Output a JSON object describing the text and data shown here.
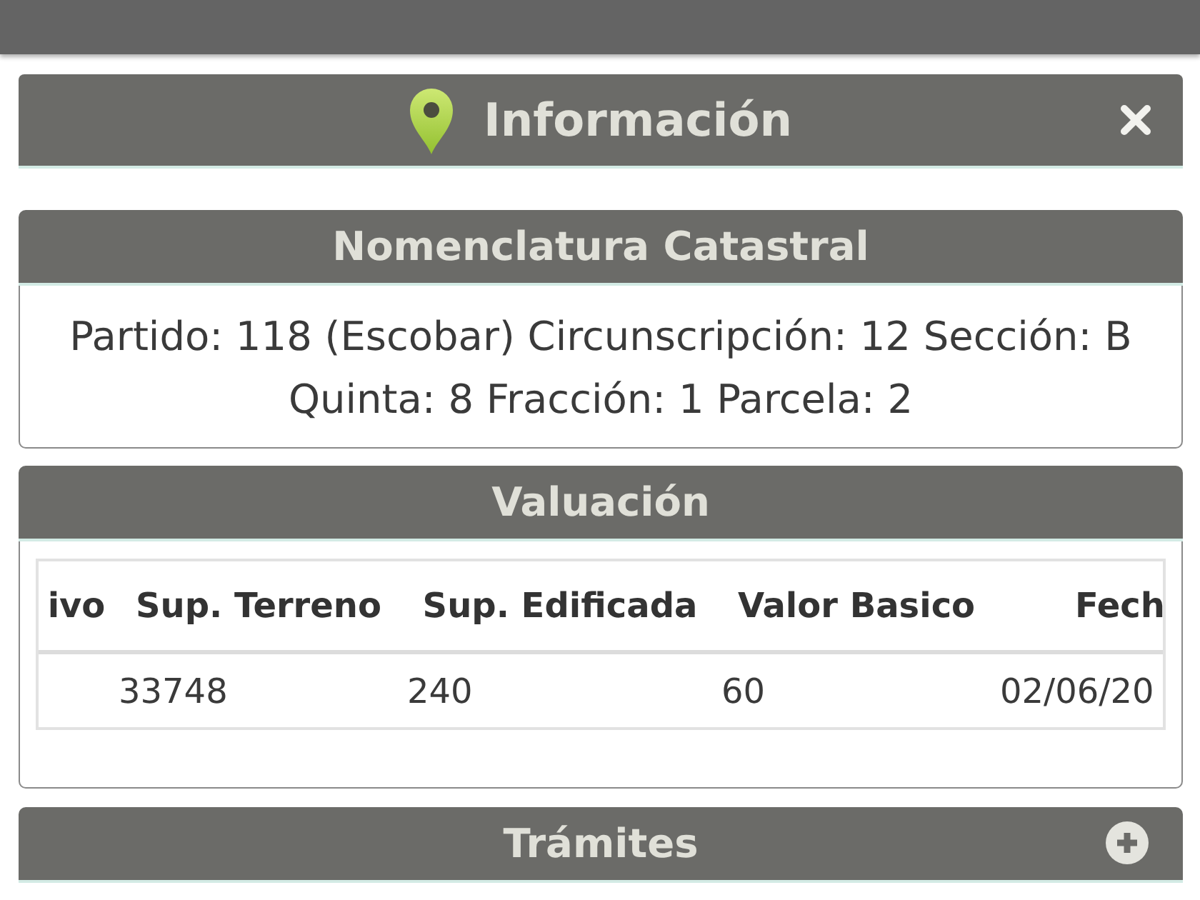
{
  "title_bar": {
    "title": "Información"
  },
  "sections": [
    {
      "kind": "text",
      "title": "Nomenclatura Catastral",
      "text": "Partido: 118 (Escobar) Circunscripción: 12 Sección: B Quinta: 8 Fracción: 1 Parcela: 2"
    },
    {
      "kind": "table",
      "title": "Valuación",
      "columns": [
        "ivo",
        "Sup. Terreno",
        "Sup. Edificada",
        "Valor Basico",
        "Fech"
      ],
      "rows": [
        {
          "cells": [
            "",
            "33748",
            "240",
            "60",
            "02/06/20"
          ]
        }
      ]
    },
    {
      "kind": "collapsible",
      "title": "Trámites",
      "expanded": false
    }
  ]
}
